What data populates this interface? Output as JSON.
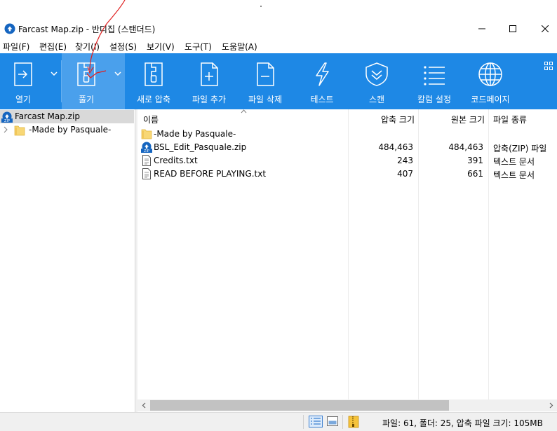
{
  "window": {
    "title": "Farcast Map.zip - 반디집 (스탠더드)",
    "minimize_glyph": "—",
    "maximize_glyph": "☐",
    "close_glyph": "✕"
  },
  "menu": [
    "파일(F)",
    "편집(E)",
    "찾기(I)",
    "설정(S)",
    "보기(V)",
    "도구(T)",
    "도움말(A)"
  ],
  "toolbar": {
    "background": "#1e88e5",
    "open_label": "열기",
    "extract_label": "풀기",
    "new_label": "새로 압축",
    "add_label": "파일 추가",
    "delete_label": "파일 삭제",
    "test_label": "테스트",
    "scan_label": "스캔",
    "columns_label": "칼럼 설정",
    "codepage_label": "코드페이지"
  },
  "tree": {
    "root_label": "Farcast Map.zip",
    "child_label": "-Made by Pasquale-"
  },
  "columns": {
    "name": "이름",
    "packed": "압축 크기",
    "original": "원본 크기",
    "type": "파일 종류"
  },
  "files": [
    {
      "name": "-Made by Pasquale-",
      "packed": "",
      "original": "",
      "type": "",
      "icon": "folder-icon"
    },
    {
      "name": "BSL_Edit_Pasquale.zip",
      "packed": "484,463",
      "original": "484,463",
      "type": "압축(ZIP) 파일",
      "icon": "zip-file-icon"
    },
    {
      "name": "Credits.txt",
      "packed": "243",
      "original": "391",
      "type": "텍스트 문서",
      "icon": "text-file-icon"
    },
    {
      "name": "READ BEFORE PLAYING.txt",
      "packed": "407",
      "original": "661",
      "type": "텍스트 문서",
      "icon": "text-file-icon"
    }
  ],
  "status": {
    "summary": "파일: 61, 폴더: 25, 압축 파일 크기: 105MB"
  }
}
